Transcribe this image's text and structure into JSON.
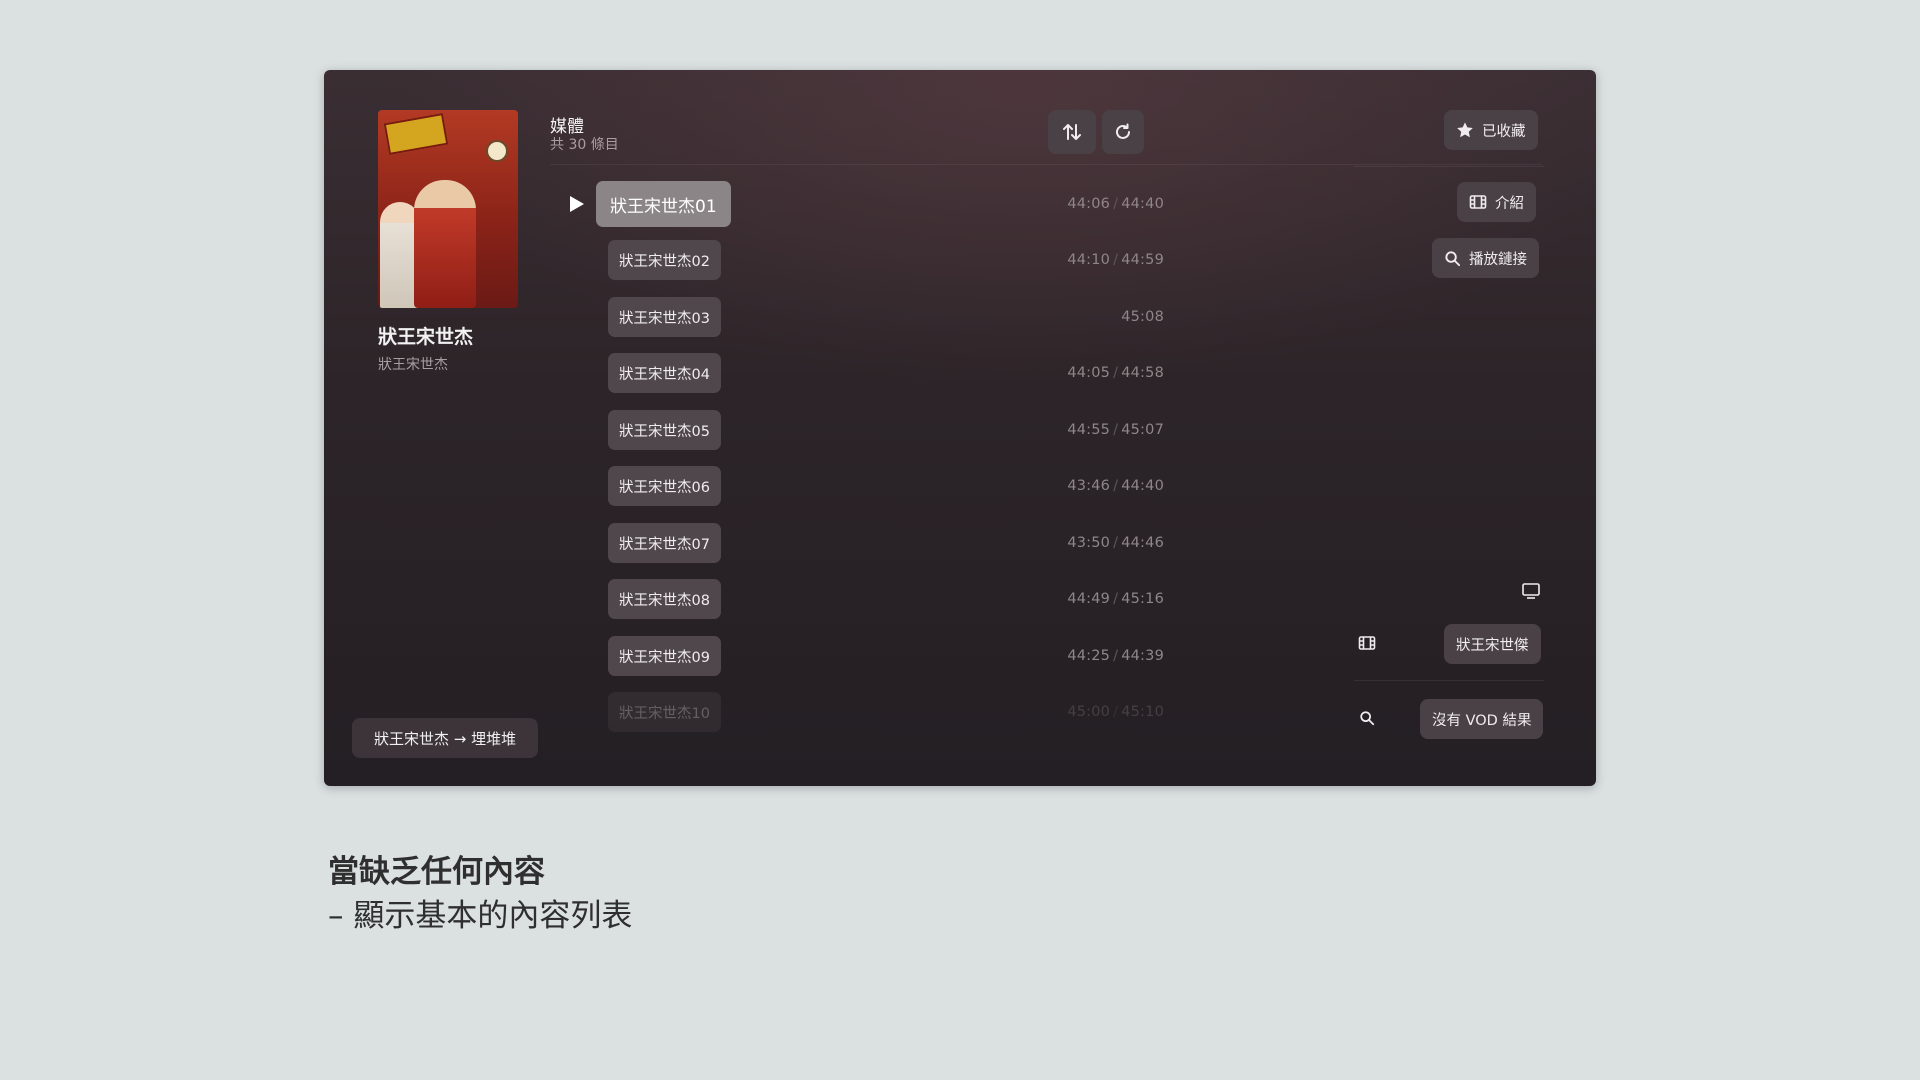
{
  "show": {
    "title": "狀王宋世杰",
    "subtitle": "狀王宋世杰",
    "redirect_label": "狀王宋世杰 → 埋堆堆"
  },
  "header": {
    "media_label": "媒體",
    "item_count": "共 30 條目",
    "sort_icon": "sort-arrows-icon",
    "refresh_icon": "refresh-icon"
  },
  "episodes": [
    {
      "label": "狀王宋世杰01",
      "progress": "44:06",
      "duration": "44:40",
      "active": true
    },
    {
      "label": "狀王宋世杰02",
      "progress": "44:10",
      "duration": "44:59"
    },
    {
      "label": "狀王宋世杰03",
      "progress": "",
      "duration": "45:08"
    },
    {
      "label": "狀王宋世杰04",
      "progress": "44:05",
      "duration": "44:58"
    },
    {
      "label": "狀王宋世杰05",
      "progress": "44:55",
      "duration": "45:07"
    },
    {
      "label": "狀王宋世杰06",
      "progress": "43:46",
      "duration": "44:40"
    },
    {
      "label": "狀王宋世杰07",
      "progress": "43:50",
      "duration": "44:46"
    },
    {
      "label": "狀王宋世杰08",
      "progress": "44:49",
      "duration": "45:16"
    },
    {
      "label": "狀王宋世杰09",
      "progress": "44:25",
      "duration": "44:39"
    },
    {
      "label": "狀王宋世杰10",
      "progress": "45:00",
      "duration": "45:10"
    }
  ],
  "time_separator": "/",
  "sidebar": {
    "favorite_label": "已收藏",
    "favorite_icon": "star-icon",
    "intro_label": "介紹",
    "intro_icon": "film-icon",
    "play_link_label": "播放鏈接",
    "play_link_icon": "search-icon",
    "tv_icon": "monitor-icon",
    "match_title_label": "狀王宋世傑",
    "match_icon": "film-icon",
    "vod_result_label": "沒有 VOD 結果",
    "vod_icon": "search-icon"
  },
  "caption": {
    "title": "當缺乏任何內容",
    "subtitle": "– 顯示基本的內容列表"
  },
  "colors": {
    "page_bg": "#dbe1e1",
    "window_bg": "#2c2428",
    "chip_bg": "#4f474b",
    "chip_active_bg": "#8c8588",
    "time_text": "#8f868a"
  }
}
